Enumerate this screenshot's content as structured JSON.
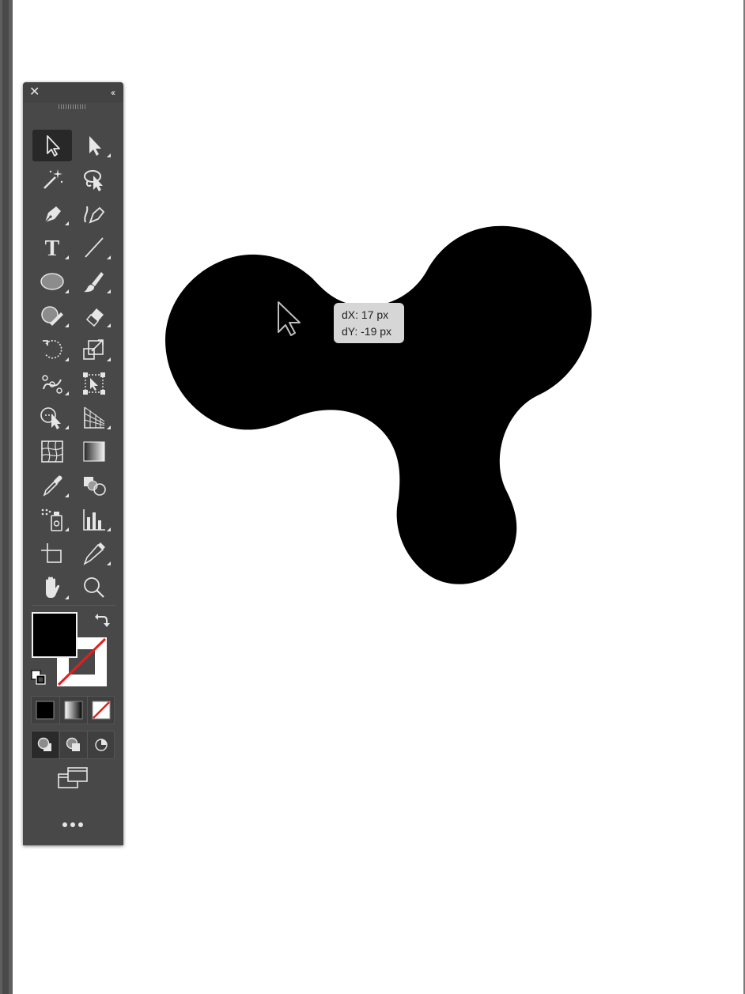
{
  "toolbox": {
    "close_glyph": "✕",
    "collapse_glyph": "‹‹",
    "tools": [
      {
        "name": "selection-tool",
        "icon": "arrow-outline-icon",
        "active": true
      },
      {
        "name": "direct-selection-tool",
        "icon": "arrow-filled-icon"
      },
      {
        "name": "magic-wand-tool",
        "icon": "magic-wand-icon"
      },
      {
        "name": "lasso-tool",
        "icon": "lasso-icon"
      },
      {
        "name": "pen-tool",
        "icon": "pen-icon"
      },
      {
        "name": "curvature-tool",
        "icon": "curvature-icon"
      },
      {
        "name": "type-tool",
        "icon": "type-icon",
        "glyph": "T"
      },
      {
        "name": "line-segment-tool",
        "icon": "line-icon"
      },
      {
        "name": "ellipse-tool",
        "icon": "ellipse-icon"
      },
      {
        "name": "paintbrush-tool",
        "icon": "brush-icon"
      },
      {
        "name": "shaper-tool",
        "icon": "shaper-icon"
      },
      {
        "name": "eraser-tool",
        "icon": "eraser-icon"
      },
      {
        "name": "rotate-tool",
        "icon": "rotate-icon"
      },
      {
        "name": "scale-tool",
        "icon": "scale-icon"
      },
      {
        "name": "puppet-warp-tool",
        "icon": "puppet-warp-icon"
      },
      {
        "name": "free-transform-tool",
        "icon": "free-transform-icon"
      },
      {
        "name": "shape-builder-tool",
        "icon": "shape-builder-icon"
      },
      {
        "name": "perspective-grid-tool",
        "icon": "perspective-grid-icon"
      },
      {
        "name": "mesh-tool",
        "icon": "mesh-icon"
      },
      {
        "name": "gradient-tool",
        "icon": "gradient-icon"
      },
      {
        "name": "eyedropper-tool",
        "icon": "eyedropper-icon"
      },
      {
        "name": "blend-tool",
        "icon": "blend-icon"
      },
      {
        "name": "symbol-sprayer-tool",
        "icon": "symbol-sprayer-icon"
      },
      {
        "name": "column-graph-tool",
        "icon": "column-graph-icon"
      },
      {
        "name": "artboard-tool",
        "icon": "artboard-icon"
      },
      {
        "name": "slice-tool",
        "icon": "slice-icon"
      },
      {
        "name": "hand-tool",
        "icon": "hand-icon"
      },
      {
        "name": "zoom-tool",
        "icon": "zoom-icon"
      }
    ],
    "fill_color": "#000000",
    "stroke": "none",
    "more_glyph": "•••"
  },
  "canvas": {
    "shape_color": "#000000",
    "tooltip": {
      "dx": "dX: 17 px",
      "dy": "dY: -19 px"
    }
  },
  "colors": {
    "panel_bg": "#484848",
    "active_tool_bg": "#282828",
    "icon_color": "#e6e6e6",
    "none_red": "#e02020"
  }
}
